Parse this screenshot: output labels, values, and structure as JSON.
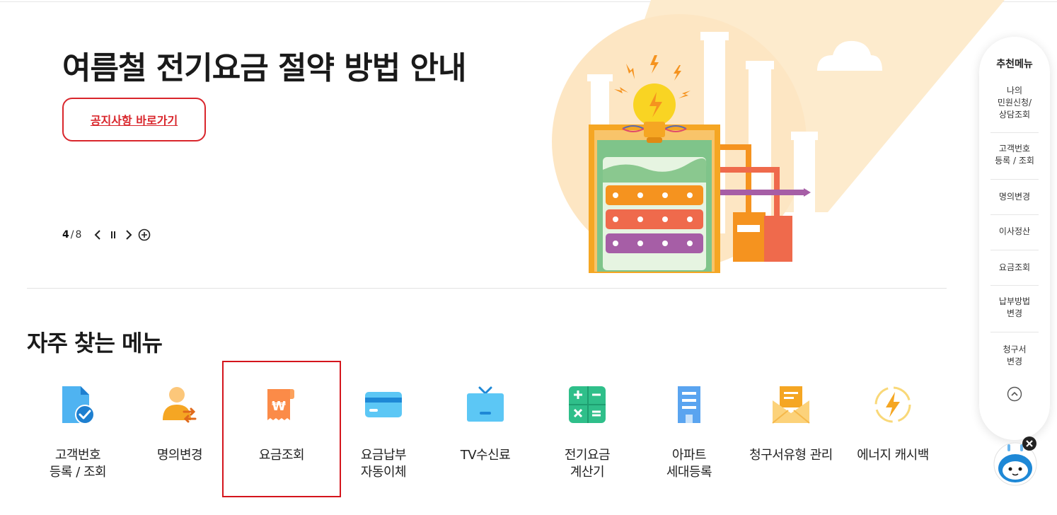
{
  "hero": {
    "title": "여름철 전기요금 절약 방법 안내",
    "button_label": "공지사항 바로가기",
    "pager": {
      "current": "4",
      "separator": "/",
      "total": "8"
    }
  },
  "section": {
    "title": "자주 찾는 메뉴"
  },
  "menu": [
    {
      "label": "고객번호\n등록 / 조회",
      "icon": "document-check-icon"
    },
    {
      "label": "명의변경",
      "icon": "person-transfer-icon"
    },
    {
      "label": "요금조회",
      "icon": "won-receipt-icon"
    },
    {
      "label": "요금납부\n자동이체",
      "icon": "credit-card-icon"
    },
    {
      "label": "TV수신료",
      "icon": "tv-icon"
    },
    {
      "label": "전기요금\n계산기",
      "icon": "calculator-icon"
    },
    {
      "label": "아파트\n세대등록",
      "icon": "apartment-icon"
    },
    {
      "label": "청구서유형 관리",
      "icon": "mail-bill-icon"
    },
    {
      "label": "에너지 캐시백",
      "icon": "energy-cashback-icon"
    }
  ],
  "quick_menu": {
    "title": "추천메뉴",
    "items": [
      "나의\n민원신청/\n상담조회",
      "고객번호\n등록 / 조회",
      "명의변경",
      "이사정산",
      "요금조회",
      "납부방법\n변경",
      "청구서\n변경"
    ]
  },
  "colors": {
    "accent_red": "#d9262c",
    "illustration_bg": "#fde9c8",
    "quick_menu_bg": "#ffffff"
  }
}
